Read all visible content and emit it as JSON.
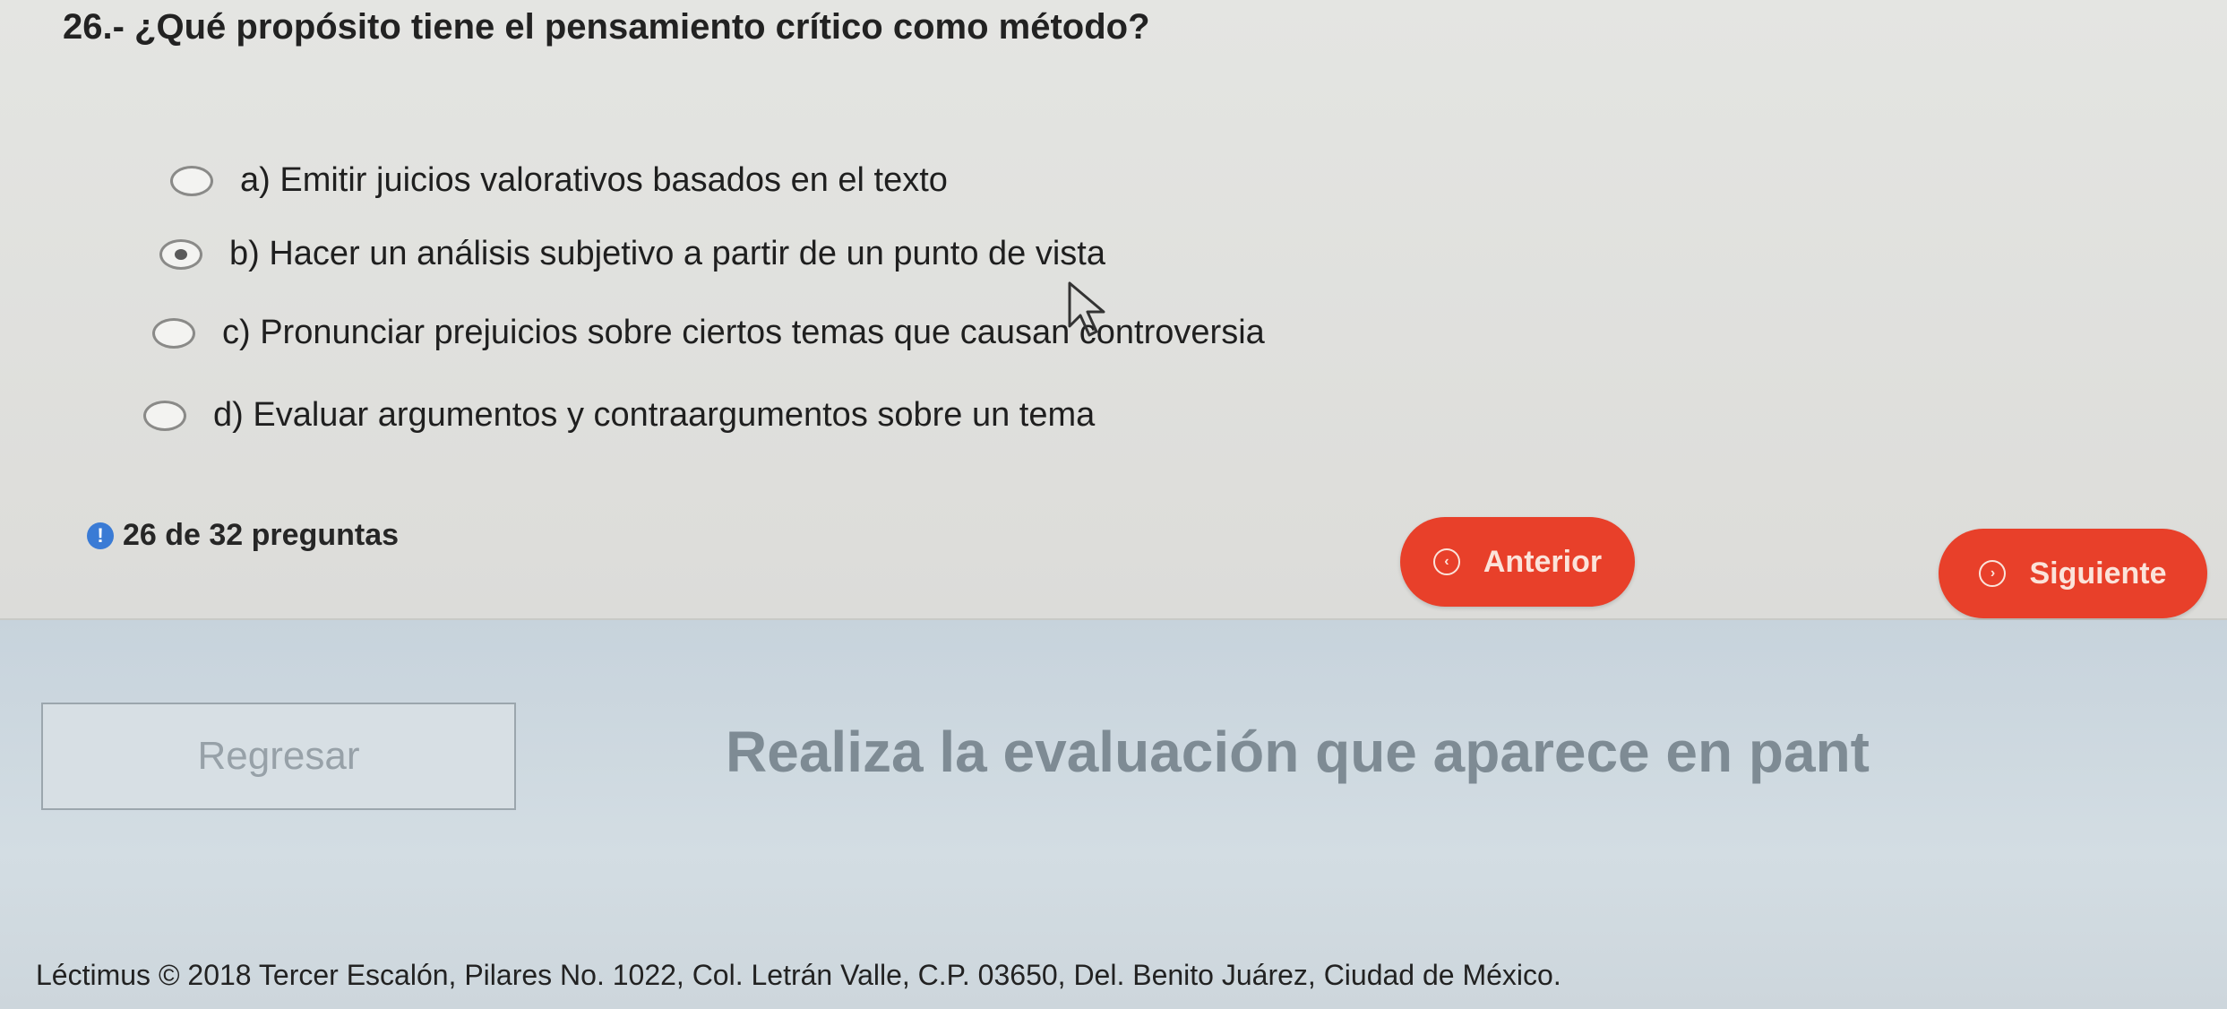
{
  "question": {
    "title": "26.- ¿Qué propósito tiene el pensamiento crítico como método?"
  },
  "options": [
    {
      "label": "a)  Emitir juicios valorativos basados en el texto",
      "selected": false
    },
    {
      "label": "b)  Hacer un análisis subjetivo a partir de un punto de vista",
      "selected": true
    },
    {
      "label": "c)  Pronunciar prejuicios sobre ciertos temas que causan controversia",
      "selected": false
    },
    {
      "label": "d)  Evaluar argumentos y contraargumentos sobre un tema",
      "selected": false
    }
  ],
  "status": {
    "progress_text": "26 de 32 preguntas",
    "icon": "info-icon"
  },
  "nav": {
    "prev_label": "Anterior",
    "next_label": "Siguiente",
    "prev_icon": "chevron-left-circle-icon",
    "next_icon": "chevron-right-circle-icon",
    "button_color": "#e8402a"
  },
  "lower": {
    "back_label": "Regresar",
    "instruction": "Realiza la evaluación que aparece en pant"
  },
  "footer": {
    "text": "Léctimus © 2018 Tercer Escalón, Pilares No. 1022, Col. Letrán Valle, C.P. 03650, Del. Benito Juárez, Ciudad de México."
  }
}
